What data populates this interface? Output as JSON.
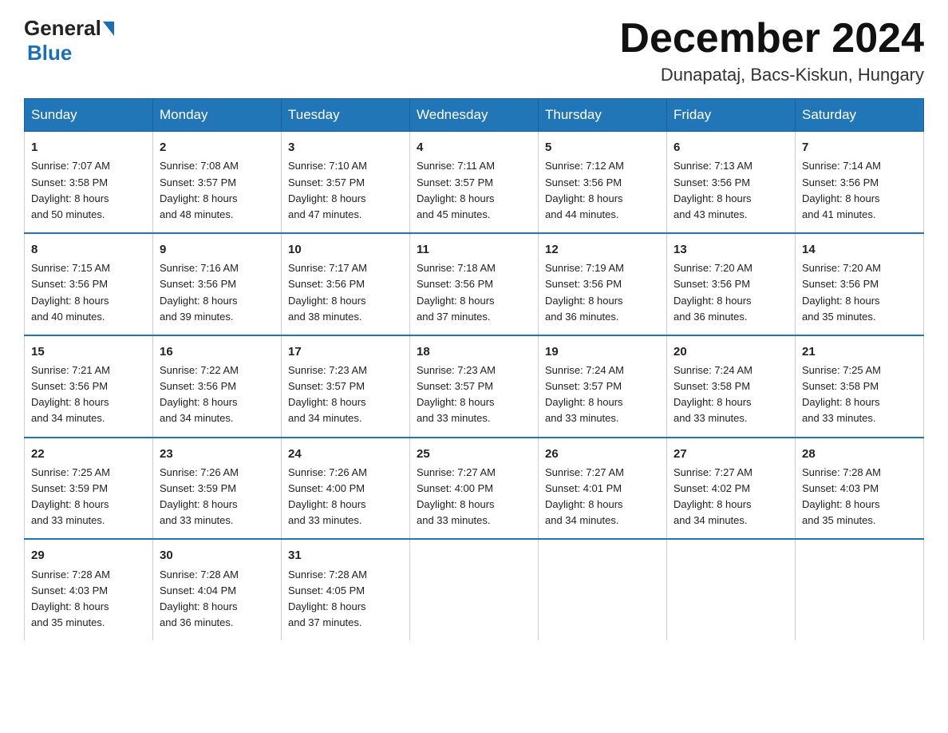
{
  "header": {
    "logo_general": "General",
    "logo_blue": "Blue",
    "month_title": "December 2024",
    "location": "Dunapataj, Bacs-Kiskun, Hungary"
  },
  "days_of_week": [
    "Sunday",
    "Monday",
    "Tuesday",
    "Wednesday",
    "Thursday",
    "Friday",
    "Saturday"
  ],
  "weeks": [
    [
      {
        "day": "1",
        "sunrise": "7:07 AM",
        "sunset": "3:58 PM",
        "daylight": "8 hours and 50 minutes."
      },
      {
        "day": "2",
        "sunrise": "7:08 AM",
        "sunset": "3:57 PM",
        "daylight": "8 hours and 48 minutes."
      },
      {
        "day": "3",
        "sunrise": "7:10 AM",
        "sunset": "3:57 PM",
        "daylight": "8 hours and 47 minutes."
      },
      {
        "day": "4",
        "sunrise": "7:11 AM",
        "sunset": "3:57 PM",
        "daylight": "8 hours and 45 minutes."
      },
      {
        "day": "5",
        "sunrise": "7:12 AM",
        "sunset": "3:56 PM",
        "daylight": "8 hours and 44 minutes."
      },
      {
        "day": "6",
        "sunrise": "7:13 AM",
        "sunset": "3:56 PM",
        "daylight": "8 hours and 43 minutes."
      },
      {
        "day": "7",
        "sunrise": "7:14 AM",
        "sunset": "3:56 PM",
        "daylight": "8 hours and 41 minutes."
      }
    ],
    [
      {
        "day": "8",
        "sunrise": "7:15 AM",
        "sunset": "3:56 PM",
        "daylight": "8 hours and 40 minutes."
      },
      {
        "day": "9",
        "sunrise": "7:16 AM",
        "sunset": "3:56 PM",
        "daylight": "8 hours and 39 minutes."
      },
      {
        "day": "10",
        "sunrise": "7:17 AM",
        "sunset": "3:56 PM",
        "daylight": "8 hours and 38 minutes."
      },
      {
        "day": "11",
        "sunrise": "7:18 AM",
        "sunset": "3:56 PM",
        "daylight": "8 hours and 37 minutes."
      },
      {
        "day": "12",
        "sunrise": "7:19 AM",
        "sunset": "3:56 PM",
        "daylight": "8 hours and 36 minutes."
      },
      {
        "day": "13",
        "sunrise": "7:20 AM",
        "sunset": "3:56 PM",
        "daylight": "8 hours and 36 minutes."
      },
      {
        "day": "14",
        "sunrise": "7:20 AM",
        "sunset": "3:56 PM",
        "daylight": "8 hours and 35 minutes."
      }
    ],
    [
      {
        "day": "15",
        "sunrise": "7:21 AM",
        "sunset": "3:56 PM",
        "daylight": "8 hours and 34 minutes."
      },
      {
        "day": "16",
        "sunrise": "7:22 AM",
        "sunset": "3:56 PM",
        "daylight": "8 hours and 34 minutes."
      },
      {
        "day": "17",
        "sunrise": "7:23 AM",
        "sunset": "3:57 PM",
        "daylight": "8 hours and 34 minutes."
      },
      {
        "day": "18",
        "sunrise": "7:23 AM",
        "sunset": "3:57 PM",
        "daylight": "8 hours and 33 minutes."
      },
      {
        "day": "19",
        "sunrise": "7:24 AM",
        "sunset": "3:57 PM",
        "daylight": "8 hours and 33 minutes."
      },
      {
        "day": "20",
        "sunrise": "7:24 AM",
        "sunset": "3:58 PM",
        "daylight": "8 hours and 33 minutes."
      },
      {
        "day": "21",
        "sunrise": "7:25 AM",
        "sunset": "3:58 PM",
        "daylight": "8 hours and 33 minutes."
      }
    ],
    [
      {
        "day": "22",
        "sunrise": "7:25 AM",
        "sunset": "3:59 PM",
        "daylight": "8 hours and 33 minutes."
      },
      {
        "day": "23",
        "sunrise": "7:26 AM",
        "sunset": "3:59 PM",
        "daylight": "8 hours and 33 minutes."
      },
      {
        "day": "24",
        "sunrise": "7:26 AM",
        "sunset": "4:00 PM",
        "daylight": "8 hours and 33 minutes."
      },
      {
        "day": "25",
        "sunrise": "7:27 AM",
        "sunset": "4:00 PM",
        "daylight": "8 hours and 33 minutes."
      },
      {
        "day": "26",
        "sunrise": "7:27 AM",
        "sunset": "4:01 PM",
        "daylight": "8 hours and 34 minutes."
      },
      {
        "day": "27",
        "sunrise": "7:27 AM",
        "sunset": "4:02 PM",
        "daylight": "8 hours and 34 minutes."
      },
      {
        "day": "28",
        "sunrise": "7:28 AM",
        "sunset": "4:03 PM",
        "daylight": "8 hours and 35 minutes."
      }
    ],
    [
      {
        "day": "29",
        "sunrise": "7:28 AM",
        "sunset": "4:03 PM",
        "daylight": "8 hours and 35 minutes."
      },
      {
        "day": "30",
        "sunrise": "7:28 AM",
        "sunset": "4:04 PM",
        "daylight": "8 hours and 36 minutes."
      },
      {
        "day": "31",
        "sunrise": "7:28 AM",
        "sunset": "4:05 PM",
        "daylight": "8 hours and 37 minutes."
      },
      null,
      null,
      null,
      null
    ]
  ],
  "labels": {
    "sunrise_prefix": "Sunrise: ",
    "sunset_prefix": "Sunset: ",
    "daylight_prefix": "Daylight: "
  }
}
